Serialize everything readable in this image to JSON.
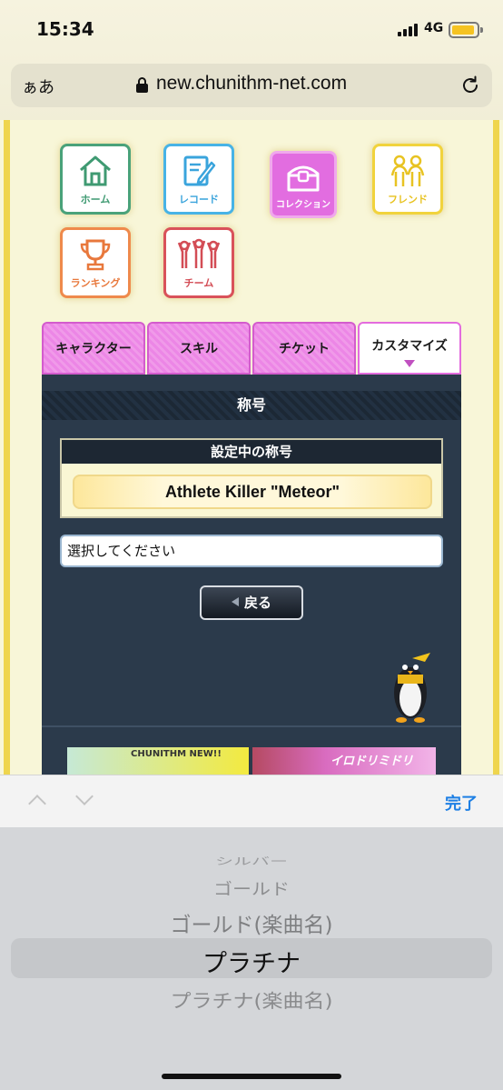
{
  "status_bar": {
    "time": "15:34",
    "network": "4G"
  },
  "browser": {
    "aa_label": "ぁあ",
    "url": "new.chunithm-net.com"
  },
  "nav": {
    "home": "ホーム",
    "record": "レコード",
    "collection": "コレクション",
    "friend": "フレンド",
    "ranking": "ランキング",
    "team": "チーム"
  },
  "tabs": [
    {
      "label": "キャラクター"
    },
    {
      "label": "スキル"
    },
    {
      "label": "チケット"
    },
    {
      "label": "カスタマイズ"
    }
  ],
  "panel": {
    "header": "称号",
    "current_title_heading": "設定中の称号",
    "current_title": "Athlete Killer \"Meteor\"",
    "select_placeholder": "選択してください",
    "back_label": "戻る"
  },
  "banners": {
    "banner1_text": "CHUNITHM NEW!!",
    "banner2_text": "イロドリミドリ"
  },
  "keyboard_bar": {
    "done_label": "完了"
  },
  "picker": {
    "options": [
      "シルバー",
      "ゴールド",
      "ゴールド(楽曲名)",
      "プラチナ",
      "プラチナ(楽曲名)"
    ],
    "selected": "プラチナ"
  }
}
